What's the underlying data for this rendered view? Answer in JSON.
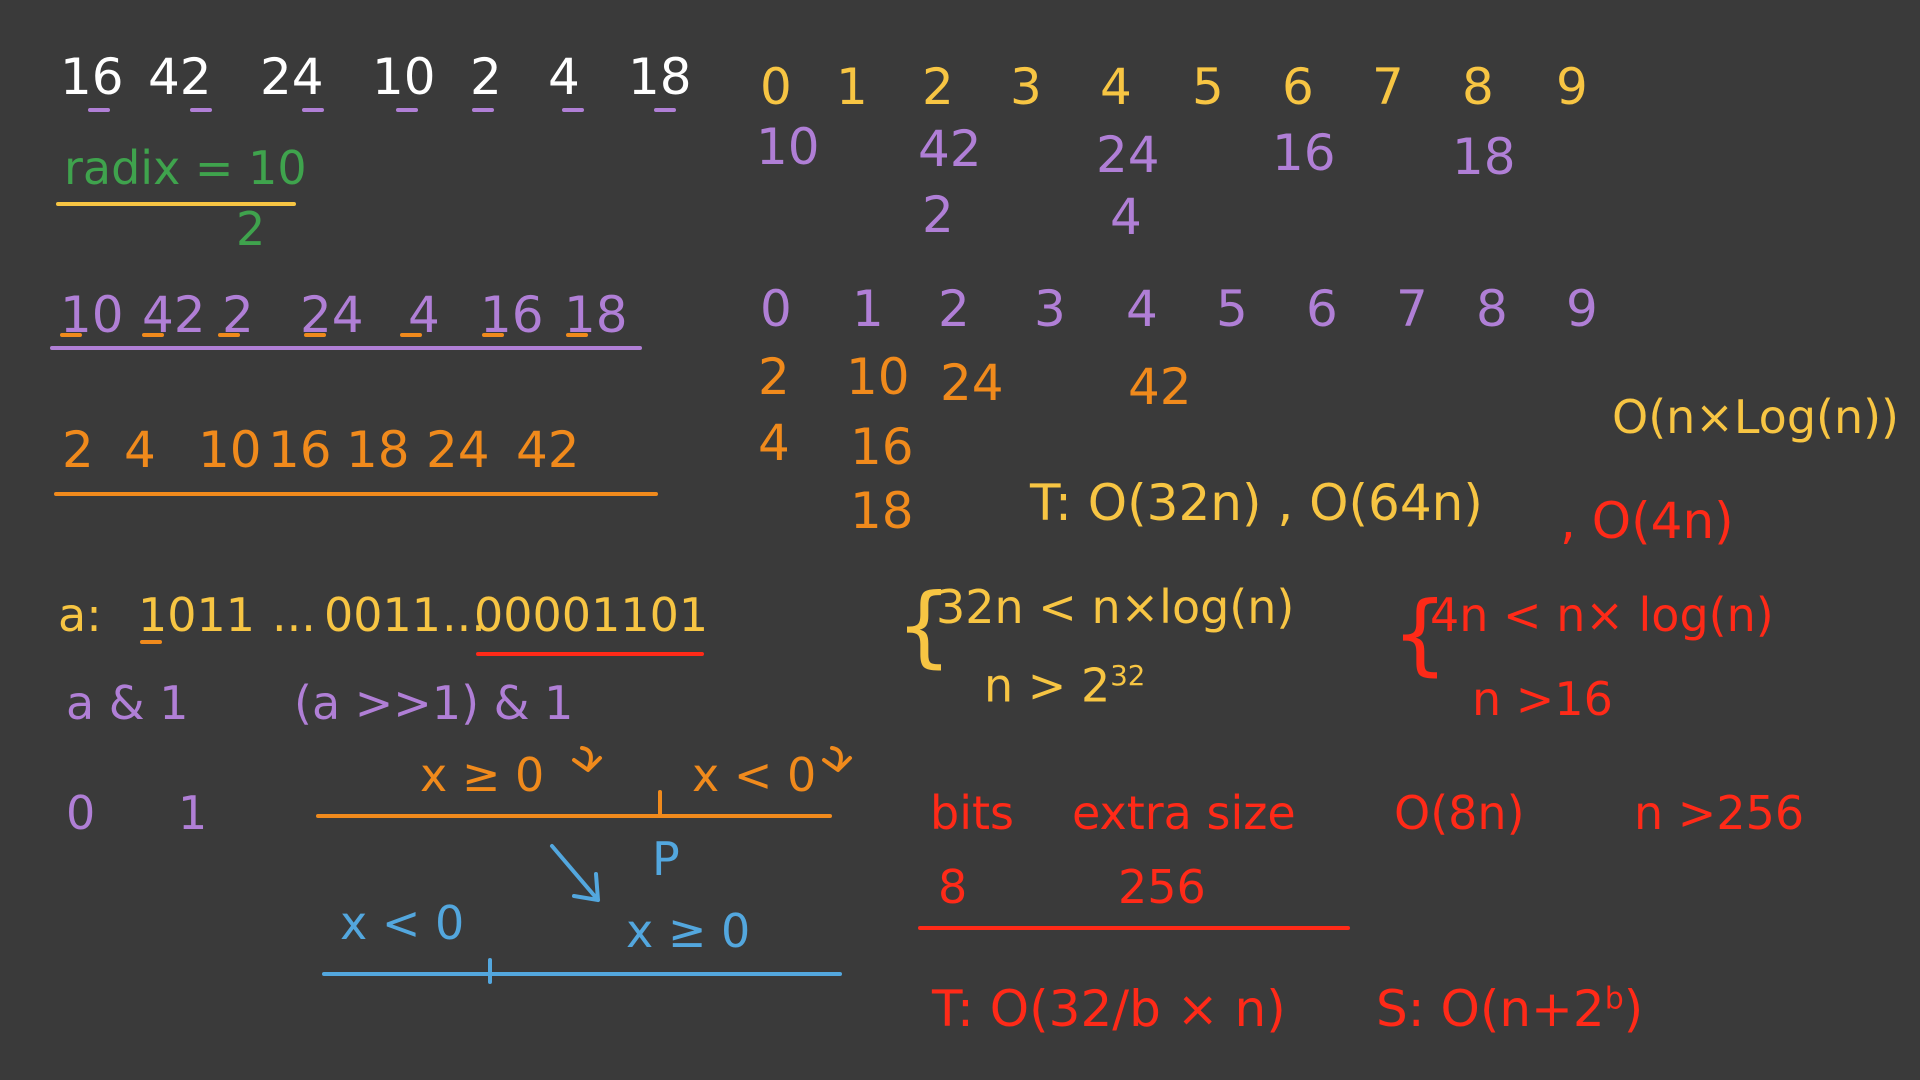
{
  "colors": {
    "background": "#3a3a3a",
    "white": "#ffffff",
    "yellow": "#f7c543",
    "orange": "#f08a1c",
    "purple": "#b07fd6",
    "green": "#3fa34d",
    "red": "#ff2a18",
    "blue": "#53a7de"
  },
  "left": {
    "input_numbers": [
      "16",
      "42",
      "24",
      "10",
      "2",
      "4",
      "18"
    ],
    "radix_label": "radix = 10",
    "radix_result": "2",
    "pass1_numbers": [
      "10",
      "42",
      "2",
      "24",
      "4",
      "16",
      "18"
    ],
    "sorted_numbers": [
      "2",
      "4",
      "10",
      "16",
      "18",
      "24",
      "42"
    ],
    "bits_line": {
      "prefix": "a:",
      "part1": "1011",
      "dots1": "...",
      "part2": "0011",
      "dots2": "...",
      "part3": "00001101"
    },
    "and_expr_1": "a & 1",
    "and_expr_2": "(a >>1) & 1",
    "bit_zero": "0",
    "bit_one": "1",
    "orange_axis": {
      "left_label": "x ≥ 0",
      "right_label": "x < 0",
      "pivot": "P"
    },
    "blue_axis": {
      "left_label": "x < 0",
      "right_label": "x ≥ 0"
    }
  },
  "buckets_first": {
    "indices": [
      "0",
      "1",
      "2",
      "3",
      "4",
      "5",
      "6",
      "7",
      "8",
      "9"
    ],
    "row1": [
      "10",
      "",
      "42",
      "",
      "24",
      "",
      "16",
      "",
      "18",
      ""
    ],
    "row2": [
      "",
      "",
      "2",
      "",
      "4",
      "",
      "",
      "",
      "",
      ""
    ]
  },
  "buckets_second": {
    "indices": [
      "0",
      "1",
      "2",
      "3",
      "4",
      "5",
      "6",
      "7",
      "8",
      "9"
    ],
    "row1": [
      "2",
      "10",
      "24",
      "",
      "42",
      "",
      "",
      "",
      "",
      ""
    ],
    "row2": [
      "4",
      "16",
      "",
      "",
      "",
      "",
      "",
      "",
      "",
      ""
    ],
    "row3": [
      "",
      "18",
      "",
      "",
      "",
      "",
      "",
      "",
      "",
      ""
    ]
  },
  "complexity": {
    "nlogn": "O(n×Log(n))",
    "t_line": "T: O(32n) , O(64n)",
    "t_line_red": ", O(4n)",
    "cond1_a": "32n < n×log(n)",
    "cond1_b_base": "n > 2",
    "cond1_b_exp": "32",
    "cond2_a": "4n < n× log(n)",
    "cond2_b": "n >16",
    "bits_header": "bits",
    "extra_header": "extra size",
    "o8n": "O(8n)",
    "n256": "n >256",
    "bits_value": "8",
    "extra_value": "256",
    "final_t": "T: O(32/b × n)",
    "final_s_base": "S: O(n+2",
    "final_s_exp": "b",
    "final_s_close": ")"
  }
}
